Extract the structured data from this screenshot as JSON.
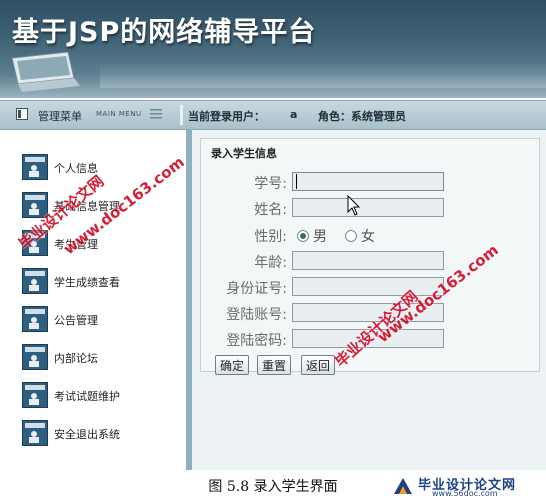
{
  "header": {
    "title": "基于JSP的网络辅导平台"
  },
  "topbar": {
    "menu_label": "管理菜单",
    "menu_sub": "MAIN MENU",
    "login_label": "当前登录用户：",
    "login_user": "a",
    "role_label": "角色：系统管理员"
  },
  "sidebar": {
    "items": [
      {
        "label": "个人信息"
      },
      {
        "label": "基础信息管理"
      },
      {
        "label": "考生管理"
      },
      {
        "label": "学生成绩查看"
      },
      {
        "label": "公告管理"
      },
      {
        "label": "内部论坛"
      },
      {
        "label": "考试试题维护"
      },
      {
        "label": "安全退出系统"
      }
    ]
  },
  "form": {
    "title": "录入学生信息",
    "fields": {
      "student_id": {
        "label": "学号:",
        "value": ""
      },
      "name": {
        "label": "姓名:",
        "value": ""
      },
      "gender": {
        "label": "性别:",
        "options": [
          "男",
          "女"
        ],
        "selected": "男"
      },
      "age": {
        "label": "年龄:",
        "value": ""
      },
      "id_card": {
        "label": "身份证号:",
        "value": ""
      },
      "login_account": {
        "label": "登陆账号:",
        "value": ""
      },
      "login_password": {
        "label": "登陆密码:",
        "value": ""
      }
    },
    "buttons": {
      "confirm": "确定",
      "reset": "重置",
      "back": "返回"
    }
  },
  "watermarks": {
    "site_name": "毕业设计论文网",
    "site_url": "www.doc163.com"
  },
  "caption": "图 5.8 录入学生界面",
  "footer_logo": {
    "name": "毕业设计论文网",
    "url": "www.56doc.com"
  },
  "colors": {
    "banner": "#3f6275",
    "topbar": "#b7cbd3",
    "sidebar_border": "#8fb0bd",
    "watermark": "#d2001b"
  }
}
